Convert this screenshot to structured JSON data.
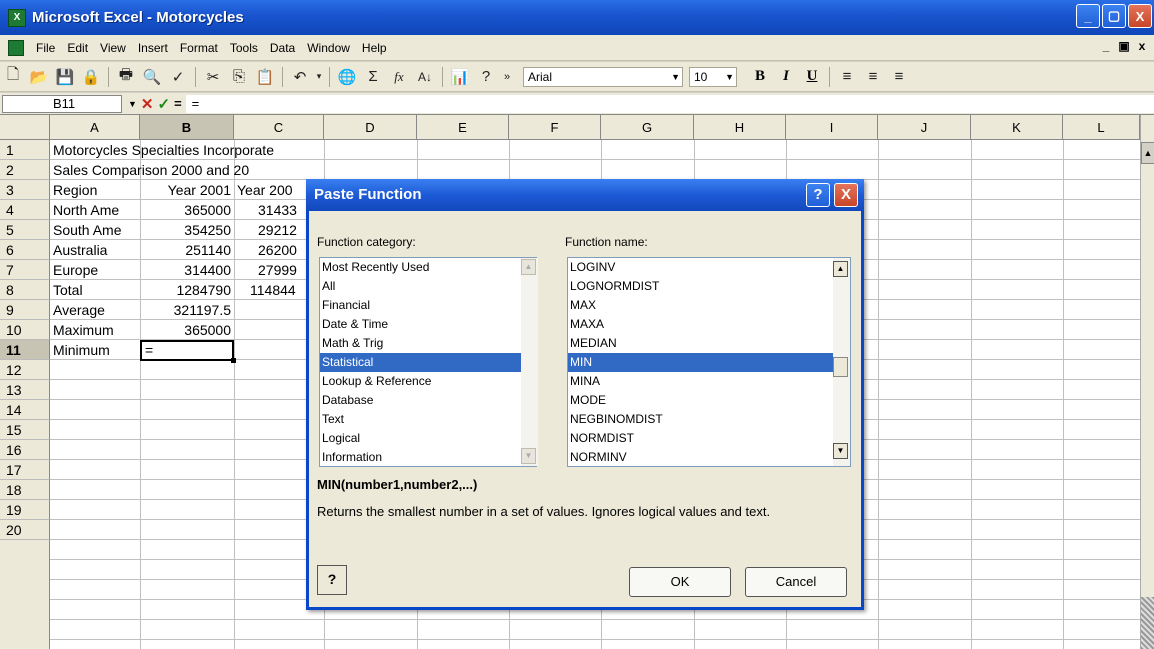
{
  "window": {
    "title": "Microsoft Excel - Motorcycles",
    "min": "_",
    "max": "▢",
    "close": "X"
  },
  "menu": {
    "items": [
      "File",
      "Edit",
      "View",
      "Insert",
      "Format",
      "Tools",
      "Data",
      "Window",
      "Help"
    ],
    "doc_min": "_",
    "doc_restore": "▣",
    "doc_close": "x"
  },
  "toolbar": {
    "font": "Arial",
    "size": "10",
    "bold": "B",
    "italic": "I",
    "underline": "U"
  },
  "formula_bar": {
    "name_box": "B11",
    "formula": "=",
    "eq": "="
  },
  "columns": [
    "A",
    "B",
    "C",
    "D",
    "E",
    "F",
    "G",
    "H",
    "I",
    "J",
    "K",
    "L"
  ],
  "rows": [
    "1",
    "2",
    "3",
    "4",
    "5",
    "6",
    "7",
    "8",
    "9",
    "10",
    "11",
    "12",
    "13",
    "14",
    "15",
    "16",
    "17",
    "18",
    "19",
    "20"
  ],
  "sheet": {
    "a1": "Motorcycles Specialties Incorporate",
    "a2": "Sales Comparison 2000 and 20",
    "a3": "Region",
    "b3": "Year 2001",
    "c3": "Year 200",
    "a4": "North Ame",
    "b4": "365000",
    "c4": "31433",
    "a5": "South Ame",
    "b5": "354250",
    "c5": "29212",
    "a6": "Australia",
    "b6": "251140",
    "c6": "26200",
    "a7": "Europe",
    "b7": "314400",
    "c7": "27999",
    "a8": "Total",
    "b8": "1284790",
    "c8": "114844",
    "a9": "Average",
    "b9": "321197.5",
    "a10": "Maximum",
    "b10": "365000",
    "a11": "Minimum",
    "b11": "="
  },
  "dialog": {
    "title": "Paste Function",
    "help": "?",
    "close": "X",
    "category_label": "Function category:",
    "name_label": "Function name:",
    "categories": [
      "Most Recently Used",
      "All",
      "Financial",
      "Date & Time",
      "Math & Trig",
      "Statistical",
      "Lookup & Reference",
      "Database",
      "Text",
      "Logical",
      "Information"
    ],
    "selected_category": "Statistical",
    "functions": [
      "LOGINV",
      "LOGNORMDIST",
      "MAX",
      "MAXA",
      "MEDIAN",
      "MIN",
      "MINA",
      "MODE",
      "NEGBINOMDIST",
      "NORMDIST",
      "NORMINV"
    ],
    "selected_function": "MIN",
    "syntax": "MIN(number1,number2,...)",
    "description": "Returns the smallest number in a set of values. Ignores logical values and text.",
    "ok": "OK",
    "cancel": "Cancel"
  }
}
